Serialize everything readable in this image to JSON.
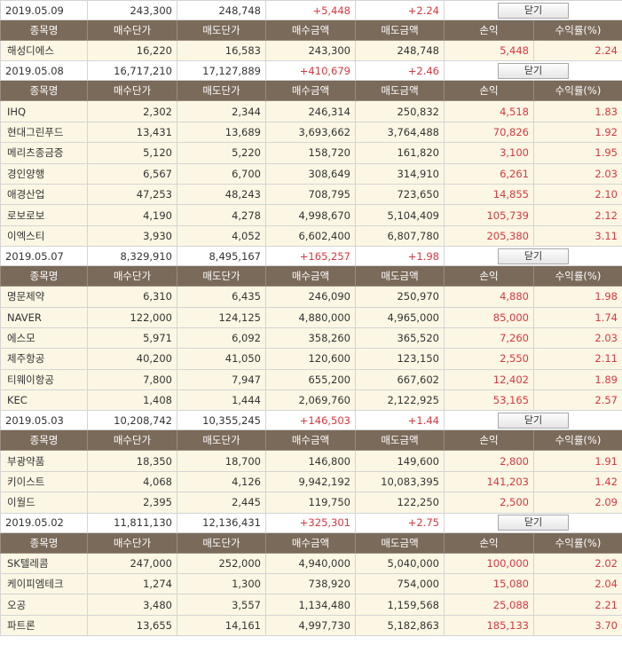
{
  "headers": [
    "종목명",
    "매수단가",
    "매도단가",
    "매수금액",
    "매도금액",
    "손익",
    "수익률(%)"
  ],
  "close_label": "닫기",
  "groups": [
    {
      "date": "2019.05.09",
      "buy": "243,300",
      "sell": "248,748",
      "pnl": "+5,448",
      "rate": "+2.24",
      "items": [
        [
          "해성디에스",
          "16,220",
          "16,583",
          "243,300",
          "248,748",
          "5,448",
          "2.24"
        ]
      ]
    },
    {
      "date": "2019.05.08",
      "buy": "16,717,210",
      "sell": "17,127,889",
      "pnl": "+410,679",
      "rate": "+2.46",
      "items": [
        [
          "IHQ",
          "2,302",
          "2,344",
          "246,314",
          "250,832",
          "4,518",
          "1.83"
        ],
        [
          "현대그린푸드",
          "13,431",
          "13,689",
          "3,693,662",
          "3,764,488",
          "70,826",
          "1.92"
        ],
        [
          "메리츠종금증",
          "5,120",
          "5,220",
          "158,720",
          "161,820",
          "3,100",
          "1.95"
        ],
        [
          "경인양행",
          "6,567",
          "6,700",
          "308,649",
          "314,910",
          "6,261",
          "2.03"
        ],
        [
          "애경산업",
          "47,253",
          "48,243",
          "708,795",
          "723,650",
          "14,855",
          "2.10"
        ],
        [
          "로보로보",
          "4,190",
          "4,278",
          "4,998,670",
          "5,104,409",
          "105,739",
          "2.12"
        ],
        [
          "이엑스티",
          "3,930",
          "4,052",
          "6,602,400",
          "6,807,780",
          "205,380",
          "3.11"
        ]
      ]
    },
    {
      "date": "2019.05.07",
      "buy": "8,329,910",
      "sell": "8,495,167",
      "pnl": "+165,257",
      "rate": "+1.98",
      "items": [
        [
          "명문제약",
          "6,310",
          "6,435",
          "246,090",
          "250,970",
          "4,880",
          "1.98"
        ],
        [
          "NAVER",
          "122,000",
          "124,125",
          "4,880,000",
          "4,965,000",
          "85,000",
          "1.74"
        ],
        [
          "에스모",
          "5,971",
          "6,092",
          "358,260",
          "365,520",
          "7,260",
          "2.03"
        ],
        [
          "제주항공",
          "40,200",
          "41,050",
          "120,600",
          "123,150",
          "2,550",
          "2.11"
        ],
        [
          "티웨이항공",
          "7,800",
          "7,947",
          "655,200",
          "667,602",
          "12,402",
          "1.89"
        ],
        [
          "KEC",
          "1,408",
          "1,444",
          "2,069,760",
          "2,122,925",
          "53,165",
          "2.57"
        ]
      ]
    },
    {
      "date": "2019.05.03",
      "buy": "10,208,742",
      "sell": "10,355,245",
      "pnl": "+146,503",
      "rate": "+1.44",
      "items": [
        [
          "부광약품",
          "18,350",
          "18,700",
          "146,800",
          "149,600",
          "2,800",
          "1.91"
        ],
        [
          "키이스트",
          "4,068",
          "4,126",
          "9,942,192",
          "10,083,395",
          "141,203",
          "1.42"
        ],
        [
          "이월드",
          "2,395",
          "2,445",
          "119,750",
          "122,250",
          "2,500",
          "2.09"
        ]
      ]
    },
    {
      "date": "2019.05.02",
      "buy": "11,811,130",
      "sell": "12,136,431",
      "pnl": "+325,301",
      "rate": "+2.75",
      "items": [
        [
          "SK텔레콤",
          "247,000",
          "252,000",
          "4,940,000",
          "5,040,000",
          "100,000",
          "2.02"
        ],
        [
          "케이피엠테크",
          "1,274",
          "1,300",
          "738,920",
          "754,000",
          "15,080",
          "2.04"
        ],
        [
          "오공",
          "3,480",
          "3,557",
          "1,134,480",
          "1,159,568",
          "25,088",
          "2.21"
        ],
        [
          "파트론",
          "13,655",
          "14,161",
          "4,997,730",
          "5,182,863",
          "185,133",
          "3.70"
        ]
      ]
    }
  ]
}
